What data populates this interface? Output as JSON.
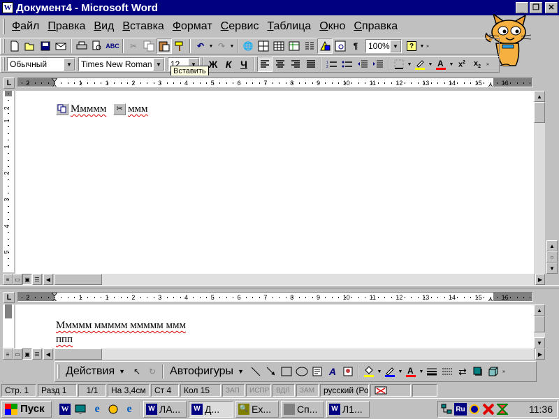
{
  "window": {
    "title": "Документ4 - Microsoft Word",
    "app_icon_letter": "W"
  },
  "menu": {
    "items": [
      {
        "label": "Файл",
        "underline": "Ф",
        "rest": "айл"
      },
      {
        "label": "Правка",
        "underline": "П",
        "rest": "равка"
      },
      {
        "label": "Вид",
        "underline": "В",
        "rest": "ид"
      },
      {
        "label": "Вставка",
        "underline": "В",
        "rest": "ставка"
      },
      {
        "label": "Формат",
        "underline": "Ф",
        "rest": "ормат"
      },
      {
        "label": "Сервис",
        "underline": "С",
        "rest": "ервис"
      },
      {
        "label": "Таблица",
        "underline": "Т",
        "rest": "аблица"
      },
      {
        "label": "Окно",
        "underline": "О",
        "rest": "кно"
      },
      {
        "label": "Справка",
        "underline": "С",
        "rest": "правка"
      }
    ]
  },
  "standard_toolbar": {
    "zoom_value": "100%"
  },
  "formatting_toolbar": {
    "style_value": "Обычный",
    "font_value": "Times New Roman",
    "size_value": "12",
    "bold_label": "Ж",
    "italic_label": "К",
    "underline_label": "Ч"
  },
  "tooltip": {
    "text": "Вставить"
  },
  "ruler": {
    "labels": [
      "1",
      "2",
      "1",
      "1",
      "2",
      "3",
      "4",
      "5",
      "6",
      "7",
      "8",
      "9",
      "10",
      "11",
      "12",
      "13",
      "14",
      "15",
      "16",
      "17"
    ]
  },
  "vruler": {
    "labels": [
      "2",
      "1",
      "1",
      "2",
      "3",
      "4",
      "5",
      "6",
      "7"
    ]
  },
  "pane1": {
    "text": "Ммммм",
    "text2": "ммм"
  },
  "pane2": {
    "line1": "Ммммм ммммм ммммм ммм",
    "line2": "ппп"
  },
  "drawing_toolbar": {
    "actions_label": "Действия",
    "autoshapes_label": "Автофигуры"
  },
  "statusbar": {
    "page": "Стр. 1",
    "section": "Разд 1",
    "pages": "1/1",
    "position": "На 3,4см",
    "line": "Ст 4",
    "column": "Кол 15",
    "rec": "ЗАП",
    "trk": "ИСПР",
    "ext": "ВДЛ",
    "ovr": "ЗАМ",
    "language": "русский (Ро"
  },
  "taskbar": {
    "start_label": "Пуск",
    "tasks": [
      {
        "label": "ЛА...",
        "active": false
      },
      {
        "label": "Д...",
        "active": true
      },
      {
        "label": "Ex...",
        "active": false
      },
      {
        "label": "Сп...",
        "active": false
      },
      {
        "label": "Л1...",
        "active": false
      }
    ],
    "tray_lang": "Ru",
    "clock": "11:36"
  },
  "colors": {
    "titlebar": "#000080",
    "face": "#c0c0c0",
    "squiggle": "#e00000",
    "tooltip": "#ffffe1"
  }
}
